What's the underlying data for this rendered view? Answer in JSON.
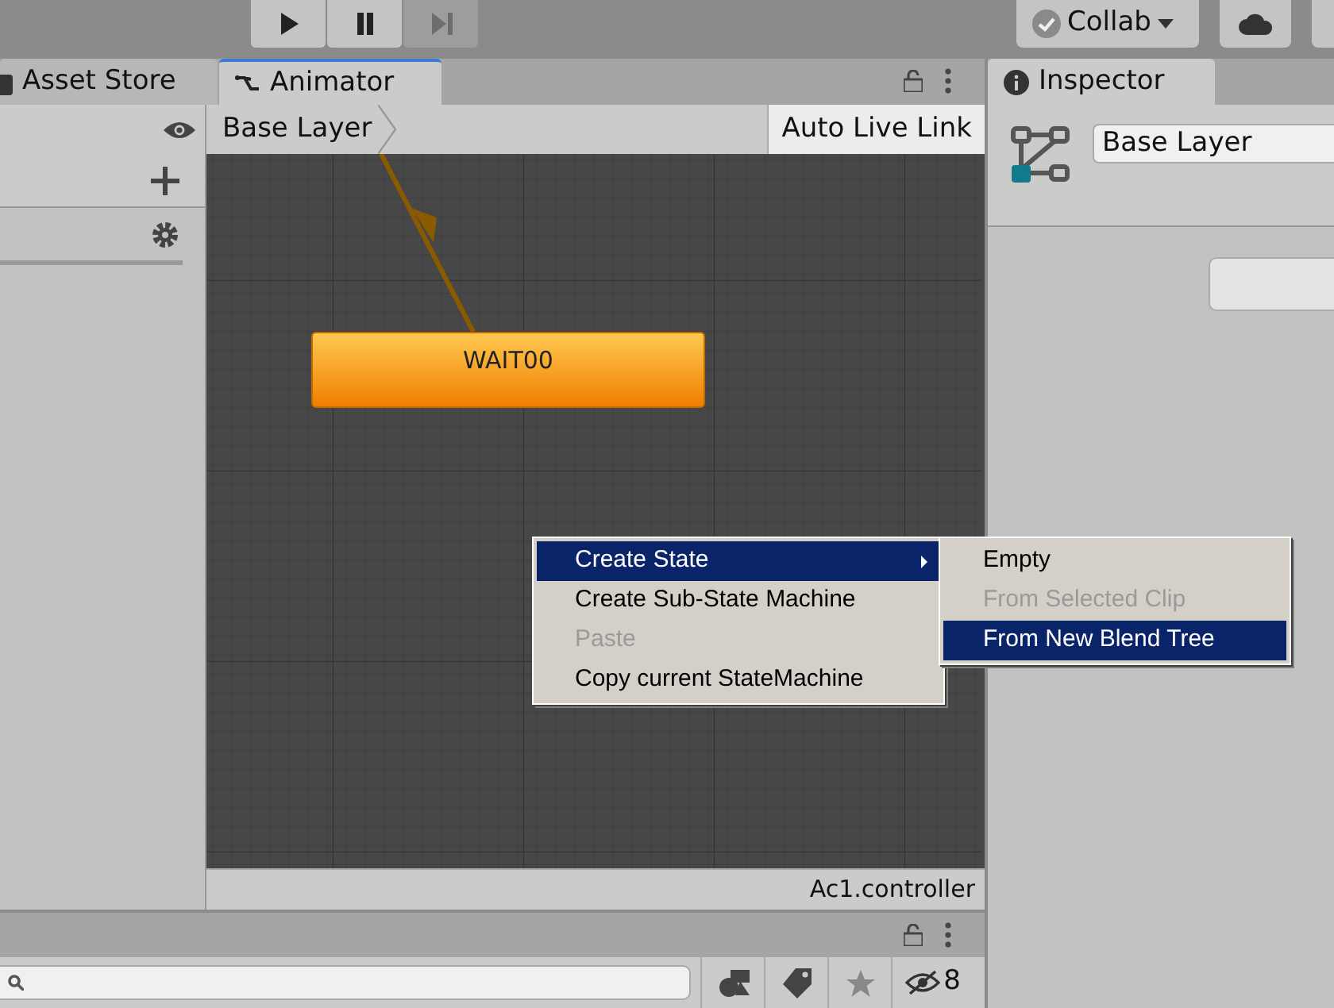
{
  "toolbar": {
    "play_controls": [
      {
        "kind": "play",
        "disabled": false
      },
      {
        "kind": "pause",
        "disabled": false
      },
      {
        "kind": "step",
        "disabled": true
      }
    ],
    "collab_button": {
      "label": "Collab"
    }
  },
  "tabs": [
    {
      "label": "Asset Store",
      "selected": false
    },
    {
      "label": "Animator",
      "selected": true
    }
  ],
  "animator": {
    "breadcrumb": "Base Layer",
    "auto_live_link": "Auto Live Link",
    "states": [
      {
        "label": "WAIT00"
      }
    ],
    "footer": "Ac1.controller"
  },
  "context_menu": {
    "items": [
      {
        "label": "Create State",
        "disabled": false,
        "selected": true,
        "has_submenu": true
      },
      {
        "label": "Create Sub-State Machine",
        "disabled": false,
        "selected": false,
        "has_submenu": false
      },
      {
        "label": "Paste",
        "disabled": true,
        "selected": false,
        "has_submenu": false
      },
      {
        "label": "Copy current StateMachine",
        "disabled": false,
        "selected": false,
        "has_submenu": false
      }
    ],
    "submenu": [
      {
        "label": "Empty",
        "disabled": false,
        "selected": false
      },
      {
        "label": "From Selected Clip",
        "disabled": true,
        "selected": false
      },
      {
        "label": "From New Blend Tree",
        "disabled": false,
        "selected": true
      }
    ]
  },
  "inspector": {
    "tab": "Inspector",
    "name_field": "Base Layer"
  },
  "bottom_panel": {
    "hidden_count": "8"
  }
}
